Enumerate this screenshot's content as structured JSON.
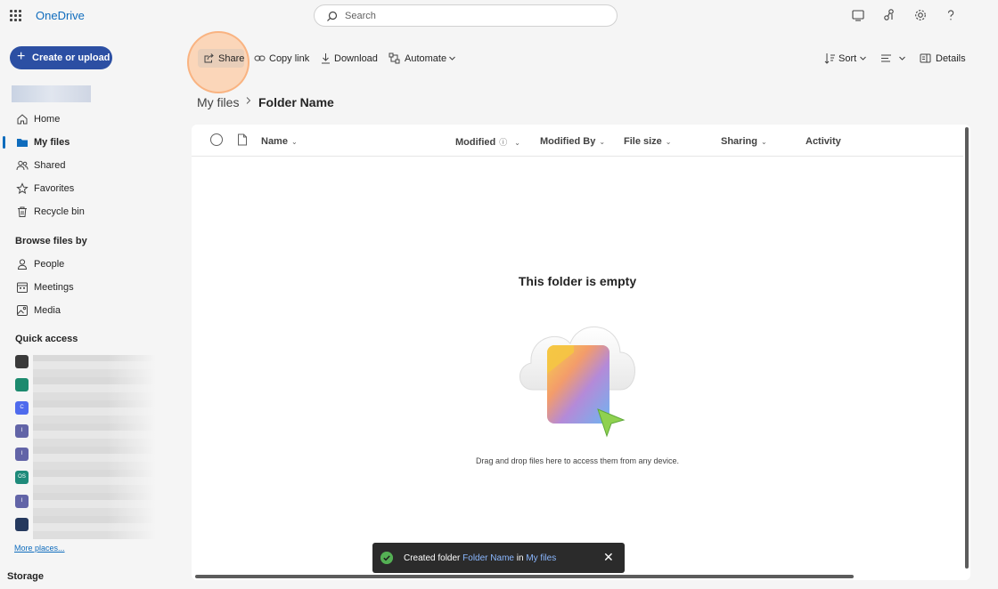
{
  "app": {
    "name": "OneDrive"
  },
  "search": {
    "placeholder": "Search"
  },
  "topbar": {
    "icons": [
      "monitor-icon",
      "diagnostics-icon",
      "settings-icon",
      "help-icon"
    ]
  },
  "sidebar": {
    "create_label": "Create or upload",
    "nav": [
      {
        "label": "Home",
        "icon": "home-icon"
      },
      {
        "label": "My files",
        "icon": "folder-icon",
        "active": true
      },
      {
        "label": "Shared",
        "icon": "people-icon"
      },
      {
        "label": "Favorites",
        "icon": "star-icon"
      },
      {
        "label": "Recycle bin",
        "icon": "trash-icon"
      }
    ],
    "browse_heading": "Browse files by",
    "browse": [
      {
        "label": "People",
        "icon": "person-icon"
      },
      {
        "label": "Meetings",
        "icon": "calendar-icon"
      },
      {
        "label": "Media",
        "icon": "image-icon"
      }
    ],
    "quick_access_heading": "Quick access",
    "quick_access_icons": [
      {
        "text": "",
        "color": "#3a3a3a"
      },
      {
        "text": "",
        "color": "#1c8a6e"
      },
      {
        "text": "C",
        "color": "#4f6bed"
      },
      {
        "text": "I",
        "color": "#6264a7"
      },
      {
        "text": "I",
        "color": "#6264a7"
      },
      {
        "text": "OS",
        "color": "#1e8a7a"
      },
      {
        "text": "I",
        "color": "#6264a7"
      },
      {
        "text": "",
        "color": "#25395e"
      }
    ],
    "more_places": "More places...",
    "storage_label": "Storage"
  },
  "commandbar": {
    "share": "Share",
    "copy_link": "Copy link",
    "download": "Download",
    "automate": "Automate",
    "sort": "Sort",
    "details": "Details"
  },
  "breadcrumb": {
    "root": "My files",
    "separator": ">",
    "current": "Folder Name"
  },
  "table": {
    "columns": [
      "Name",
      "Modified",
      "Modified By",
      "File size",
      "Sharing",
      "Activity"
    ]
  },
  "empty": {
    "title": "This folder is empty",
    "subtitle": "Drag and drop files here to access them from any device."
  },
  "toast": {
    "prefix": "Created folder ",
    "folder": "Folder Name",
    "middle": " in ",
    "location": "My files"
  }
}
